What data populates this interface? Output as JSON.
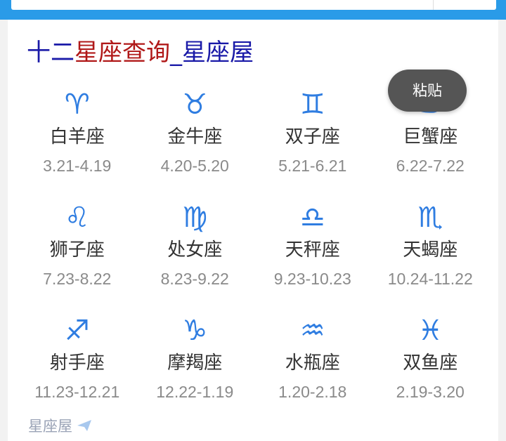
{
  "header": {
    "title_part1": "十二",
    "title_part2": "星座查询",
    "title_part3": "_星座屋"
  },
  "colors": {
    "top_bar": "#2a9be8",
    "symbol": "#2f7de1",
    "title_blue": "#1a1aa8",
    "title_red": "#b01818"
  },
  "zodiac": [
    {
      "symbol": "♈",
      "name": "白羊座",
      "date": "3.21-4.19"
    },
    {
      "symbol": "♉",
      "name": "金牛座",
      "date": "4.20-5.20"
    },
    {
      "symbol": "♊",
      "name": "双子座",
      "date": "5.21-6.21"
    },
    {
      "symbol": "♋",
      "name": "巨蟹座",
      "date": "6.22-7.22"
    },
    {
      "symbol": "♌",
      "name": "狮子座",
      "date": "7.23-8.22"
    },
    {
      "symbol": "♍",
      "name": "处女座",
      "date": "8.23-9.22"
    },
    {
      "symbol": "♎",
      "name": "天秤座",
      "date": "9.23-10.23"
    },
    {
      "symbol": "♏",
      "name": "天蝎座",
      "date": "10.24-11.22"
    },
    {
      "symbol": "♐",
      "name": "射手座",
      "date": "11.23-12.21"
    },
    {
      "symbol": "♑",
      "name": "摩羯座",
      "date": "12.22-1.19"
    },
    {
      "symbol": "♒",
      "name": "水瓶座",
      "date": "1.20-2.18"
    },
    {
      "symbol": "♓",
      "name": "双鱼座",
      "date": "2.19-3.20"
    }
  ],
  "tooltip": {
    "label": "粘贴"
  },
  "footer": {
    "link_text": "星座屋",
    "icon": "send-icon"
  }
}
